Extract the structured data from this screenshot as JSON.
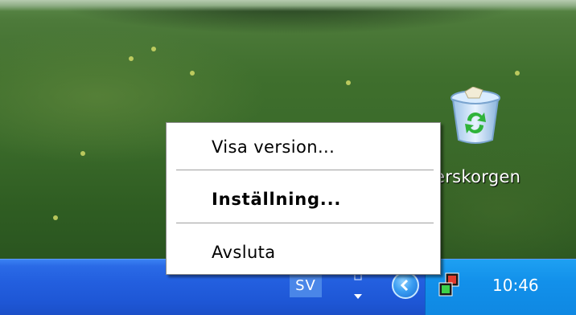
{
  "desktop": {
    "recycle_bin": {
      "label": "Papperskorgen",
      "visible_label": "erskorgen"
    }
  },
  "context_menu": {
    "items": [
      {
        "label": "Visa version...",
        "bold": false
      },
      {
        "label": "Inställning...",
        "bold": true
      },
      {
        "label": "Avsluta",
        "bold": false
      }
    ]
  },
  "taskbar": {
    "language": "SV",
    "clock": "10:46",
    "colors": {
      "taskbar": "#235fdf",
      "tray": "#1290ea",
      "menu_background": "#ffffff"
    },
    "icons": [
      "language-options-icon",
      "show-hidden-icons-chevron-icon",
      "tray-app-icon"
    ]
  }
}
